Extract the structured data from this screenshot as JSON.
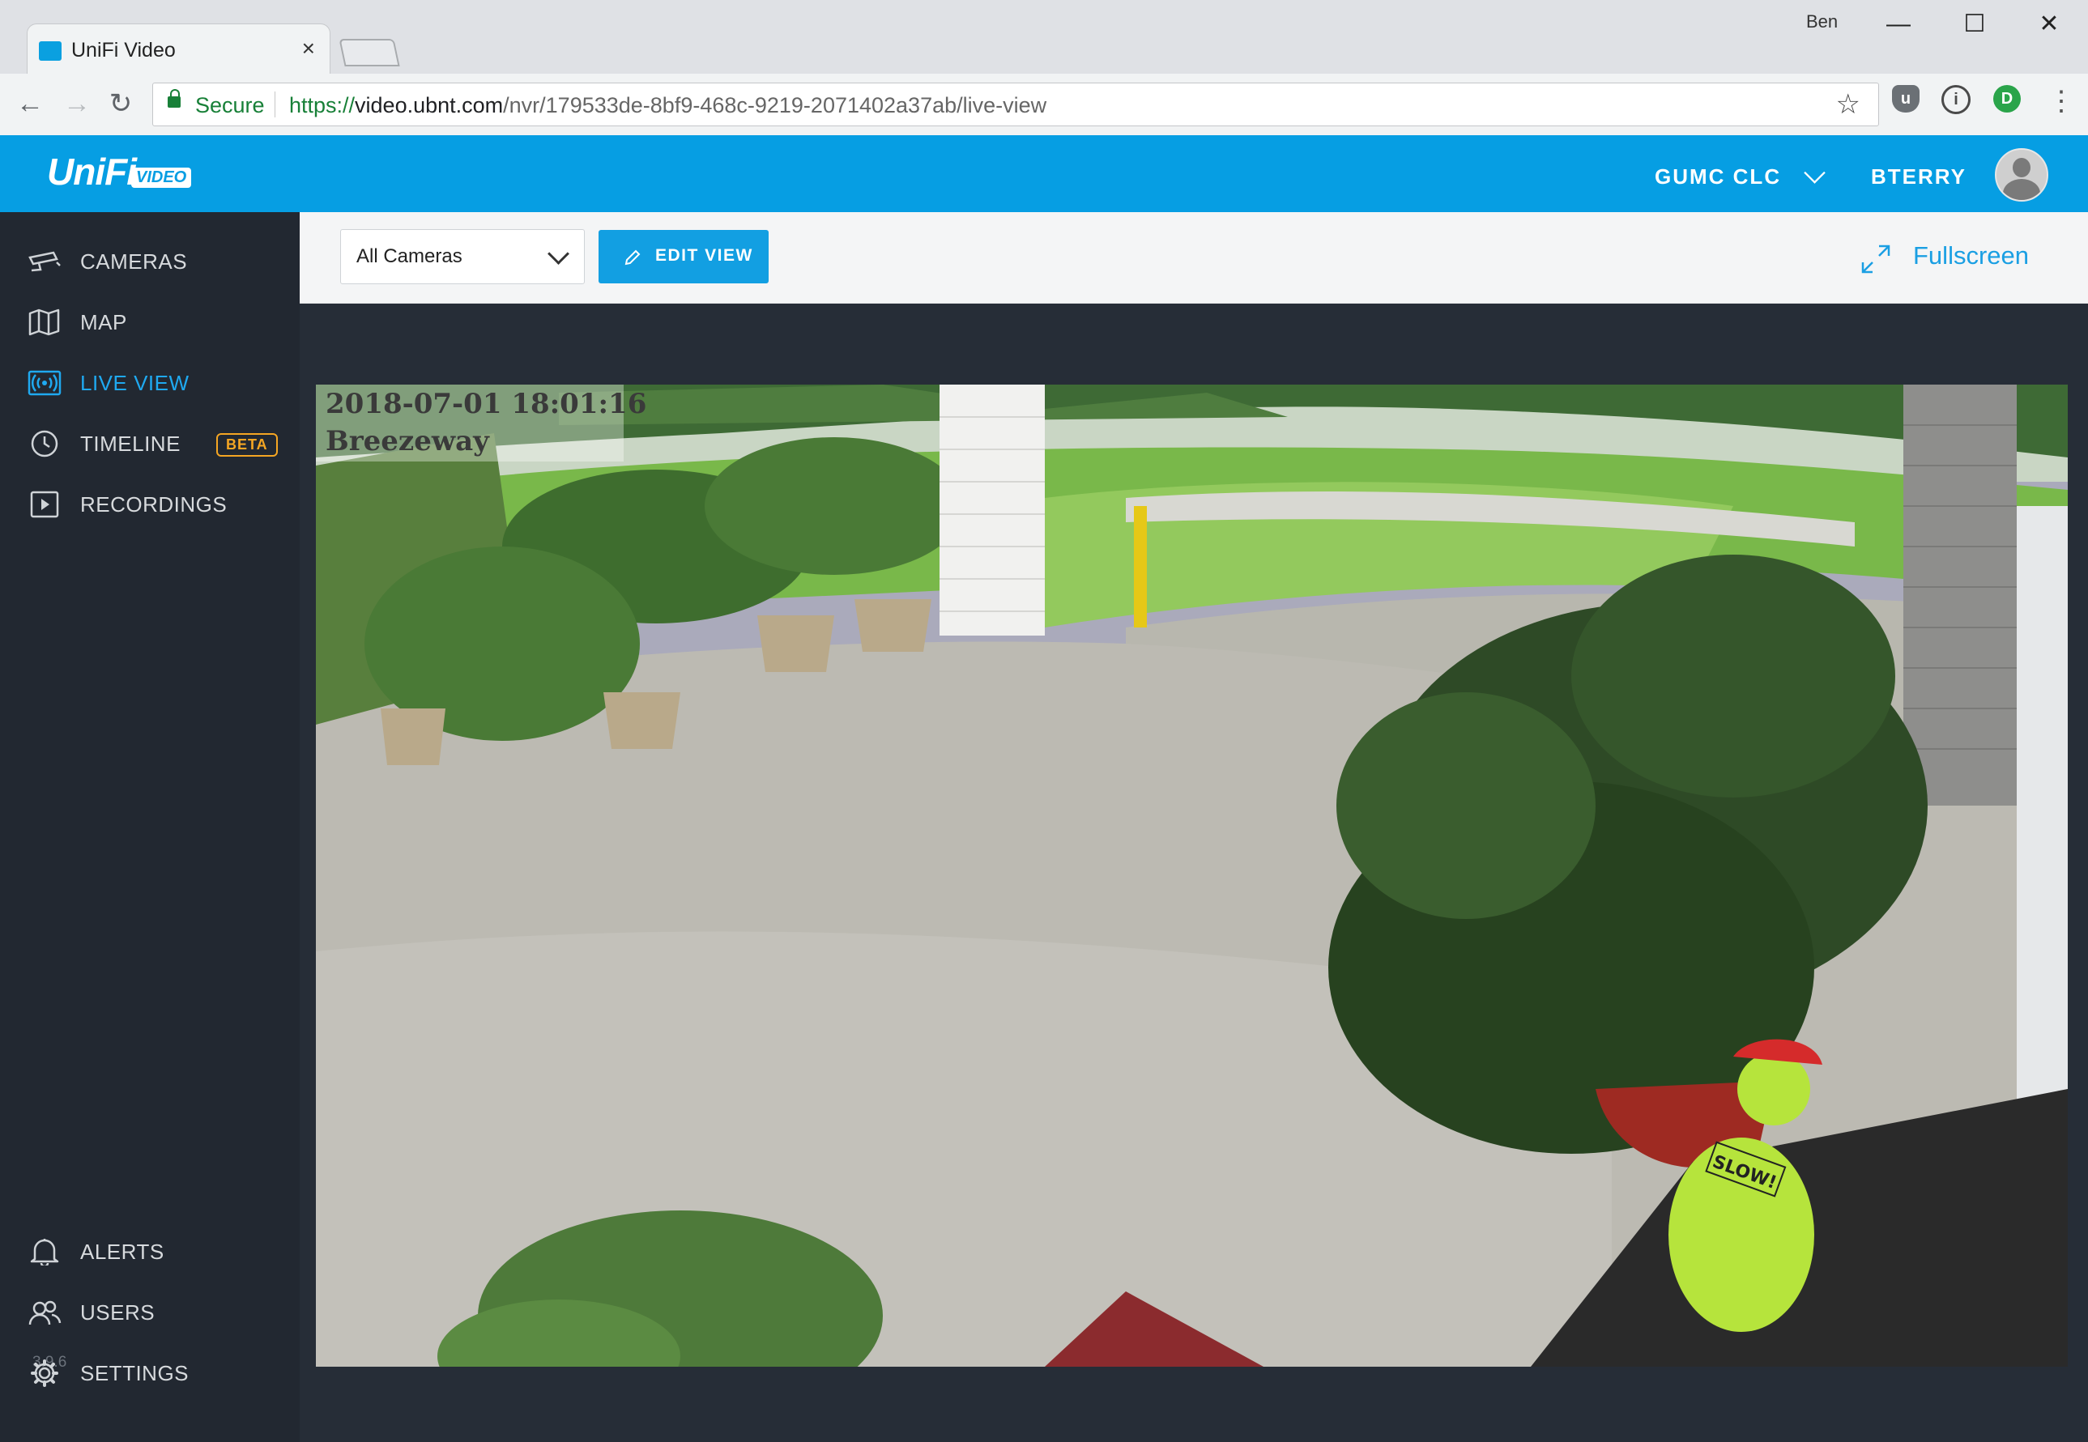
{
  "browser": {
    "tab_title": "UniFi Video",
    "tab_close": "×",
    "profile_name": "Ben",
    "window_controls": {
      "minimize": "—",
      "maximize": "☐",
      "close": "✕"
    },
    "secure_label": "Secure",
    "url_scheme": "https://",
    "url_host": "video.ubnt.com",
    "url_path": "/nvr/179533de-8bf9-468c-9219-2071402a37ab/live-view"
  },
  "app": {
    "logo_text": "UniFi",
    "logo_sub": "VIDEO",
    "site_name": "GUMC CLC",
    "username": "BTERRY",
    "accent_color": "#069ee3"
  },
  "sidebar": {
    "items": [
      {
        "label": "CAMERAS",
        "icon": "camera-icon"
      },
      {
        "label": "MAP",
        "icon": "map-icon"
      },
      {
        "label": "LIVE VIEW",
        "icon": "live-view-icon"
      },
      {
        "label": "TIMELINE",
        "icon": "clock-icon",
        "badge": "BETA"
      },
      {
        "label": "RECORDINGS",
        "icon": "play-icon"
      }
    ],
    "version": "3.9.6",
    "bottom_items": [
      {
        "label": "ALERTS",
        "icon": "bell-icon"
      },
      {
        "label": "USERS",
        "icon": "users-icon"
      },
      {
        "label": "SETTINGS",
        "icon": "gear-icon"
      }
    ]
  },
  "viewbar": {
    "camera_filter": "All Cameras",
    "edit_view_label": "EDIT VIEW",
    "fullscreen_label": "Fullscreen"
  },
  "feed": {
    "timestamp": "2018-07-01 18:01:16",
    "camera_name": "Breezeway"
  }
}
